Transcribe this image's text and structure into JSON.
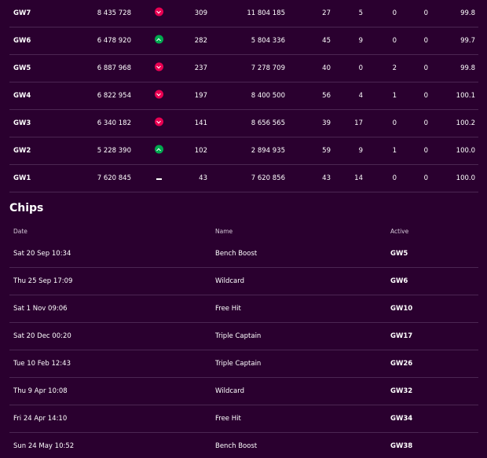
{
  "gameweeks": [
    {
      "gw": "GW7",
      "points": "8 435 728",
      "movement": "down",
      "movement_icon": "chevron-down-icon",
      "rank": "309",
      "total": "11 804 185",
      "transfers": "27",
      "transfer_cost": "5",
      "hits": "0",
      "bench": "0",
      "value": "99.8"
    },
    {
      "gw": "GW6",
      "points": "6 478 920",
      "movement": "up",
      "movement_icon": "chevron-up-icon",
      "rank": "282",
      "total": "5 804 336",
      "transfers": "45",
      "transfer_cost": "9",
      "hits": "0",
      "bench": "0",
      "value": "99.7"
    },
    {
      "gw": "GW5",
      "points": "6 887 968",
      "movement": "down",
      "movement_icon": "chevron-down-icon",
      "rank": "237",
      "total": "7 278 709",
      "transfers": "40",
      "transfer_cost": "0",
      "hits": "2",
      "bench": "0",
      "value": "99.8"
    },
    {
      "gw": "GW4",
      "points": "6 822 954",
      "movement": "down",
      "movement_icon": "chevron-down-icon",
      "rank": "197",
      "total": "8 400 500",
      "transfers": "56",
      "transfer_cost": "4",
      "hits": "1",
      "bench": "0",
      "value": "100.1"
    },
    {
      "gw": "GW3",
      "points": "6 340 182",
      "movement": "down",
      "movement_icon": "chevron-down-icon",
      "rank": "141",
      "total": "8 656 565",
      "transfers": "39",
      "transfer_cost": "17",
      "hits": "0",
      "bench": "0",
      "value": "100.2"
    },
    {
      "gw": "GW2",
      "points": "5 228 390",
      "movement": "up",
      "movement_icon": "chevron-up-icon",
      "rank": "102",
      "total": "2 894 935",
      "transfers": "59",
      "transfer_cost": "9",
      "hits": "1",
      "bench": "0",
      "value": "100.0"
    },
    {
      "gw": "GW1",
      "points": "7 620 845",
      "movement": "none",
      "movement_icon": "dash-icon",
      "rank": "43",
      "total": "7 620 856",
      "transfers": "43",
      "transfer_cost": "14",
      "hits": "0",
      "bench": "0",
      "value": "100.0"
    }
  ],
  "chips": {
    "title": "Chips",
    "headers": {
      "date": "Date",
      "name": "Name",
      "active": "Active"
    },
    "rows": [
      {
        "date": "Sat 20 Sep 10:34",
        "name": "Bench Boost",
        "active": "GW5"
      },
      {
        "date": "Thu 25 Sep 17:09",
        "name": "Wildcard",
        "active": "GW6"
      },
      {
        "date": "Sat 1 Nov 09:06",
        "name": "Free Hit",
        "active": "GW10"
      },
      {
        "date": "Sat 20 Dec 00:20",
        "name": "Triple Captain",
        "active": "GW17"
      },
      {
        "date": "Tue 10 Feb 12:43",
        "name": "Triple Captain",
        "active": "GW26"
      },
      {
        "date": "Thu 9 Apr 10:08",
        "name": "Wildcard",
        "active": "GW32"
      },
      {
        "date": "Fri 24 Apr 14:10",
        "name": "Free Hit",
        "active": "GW34"
      },
      {
        "date": "Sun 24 May 10:52",
        "name": "Bench Boost",
        "active": "GW38"
      }
    ]
  },
  "colors": {
    "background": "#2a002f",
    "divider": "#4b2652",
    "down": "#e90052",
    "up": "#01a94f"
  }
}
